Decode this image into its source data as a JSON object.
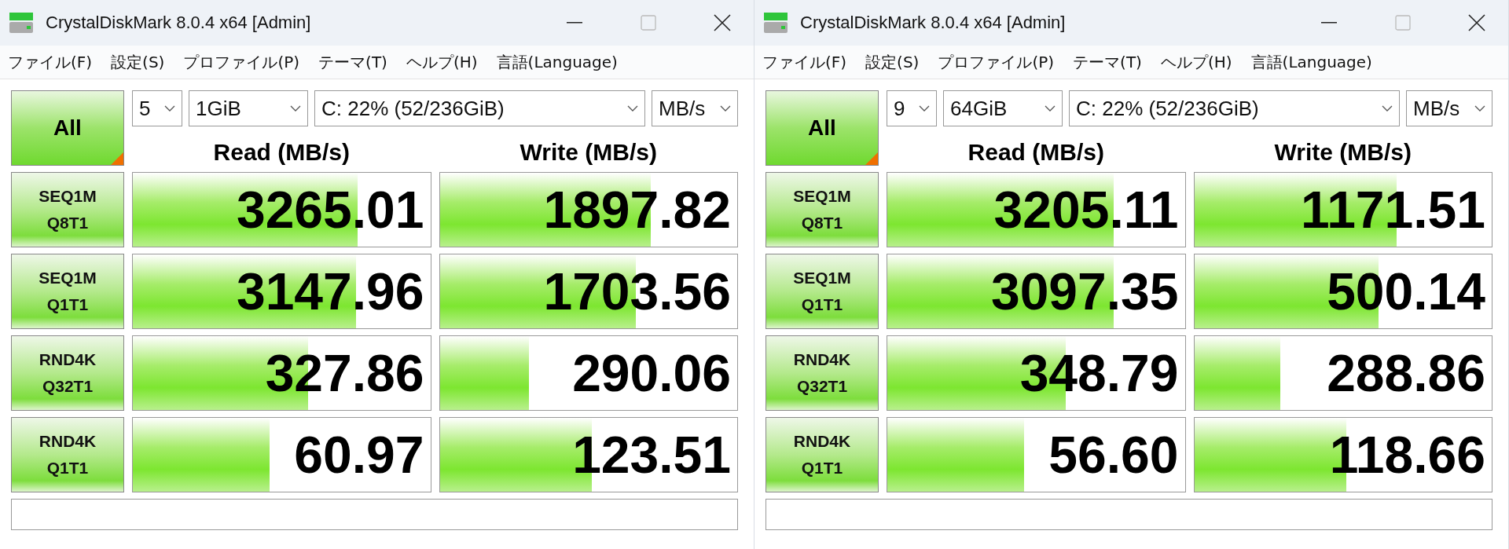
{
  "windows": [
    {
      "title": "CrystalDiskMark 8.0.4 x64 [Admin]",
      "menu": [
        "ファイル(F)",
        "設定(S)",
        "プロファイル(P)",
        "テーマ(T)",
        "ヘルプ(H)",
        "言語(Language)"
      ],
      "all_button": "All",
      "count": "5",
      "size": "1GiB",
      "drive": "C: 22% (52/236GiB)",
      "unit": "MB/s",
      "read_header": "Read (MB/s)",
      "write_header": "Write (MB/s)",
      "tests": [
        {
          "label_1": "SEQ1M",
          "label_2": "Q8T1",
          "read": {
            "value": "3265.01",
            "level": 0.755
          },
          "write": {
            "value": "1897.82",
            "level": 0.71
          }
        },
        {
          "label_1": "SEQ1M",
          "label_2": "Q1T1",
          "read": {
            "value": "3147.96",
            "level": 0.75
          },
          "write": {
            "value": "1703.56",
            "level": 0.66
          }
        },
        {
          "label_1": "RND4K",
          "label_2": "Q32T1",
          "read": {
            "value": "327.86",
            "level": 0.59
          },
          "write": {
            "value": "290.06",
            "level": 0.3
          }
        },
        {
          "label_1": "RND4K",
          "label_2": "Q1T1",
          "read": {
            "value": "60.97",
            "level": 0.46
          },
          "write": {
            "value": "123.51",
            "level": 0.51
          }
        }
      ]
    },
    {
      "title": "CrystalDiskMark 8.0.4 x64 [Admin]",
      "menu": [
        "ファイル(F)",
        "設定(S)",
        "プロファイル(P)",
        "テーマ(T)",
        "ヘルプ(H)",
        "言語(Language)"
      ],
      "all_button": "All",
      "count": "9",
      "size": "64GiB",
      "drive": "C: 22% (52/236GiB)",
      "unit": "MB/s",
      "read_header": "Read (MB/s)",
      "write_header": "Write (MB/s)",
      "tests": [
        {
          "label_1": "SEQ1M",
          "label_2": "Q8T1",
          "read": {
            "value": "3205.11",
            "level": 0.76
          },
          "write": {
            "value": "1171.51",
            "level": 0.68
          }
        },
        {
          "label_1": "SEQ1M",
          "label_2": "Q1T1",
          "read": {
            "value": "3097.35",
            "level": 0.76
          },
          "write": {
            "value": "500.14",
            "level": 0.62
          }
        },
        {
          "label_1": "RND4K",
          "label_2": "Q32T1",
          "read": {
            "value": "348.79",
            "level": 0.6
          },
          "write": {
            "value": "288.86",
            "level": 0.29
          }
        },
        {
          "label_1": "RND4K",
          "label_2": "Q1T1",
          "read": {
            "value": "56.60",
            "level": 0.46
          },
          "write": {
            "value": "118.66",
            "level": 0.51
          }
        }
      ]
    }
  ]
}
